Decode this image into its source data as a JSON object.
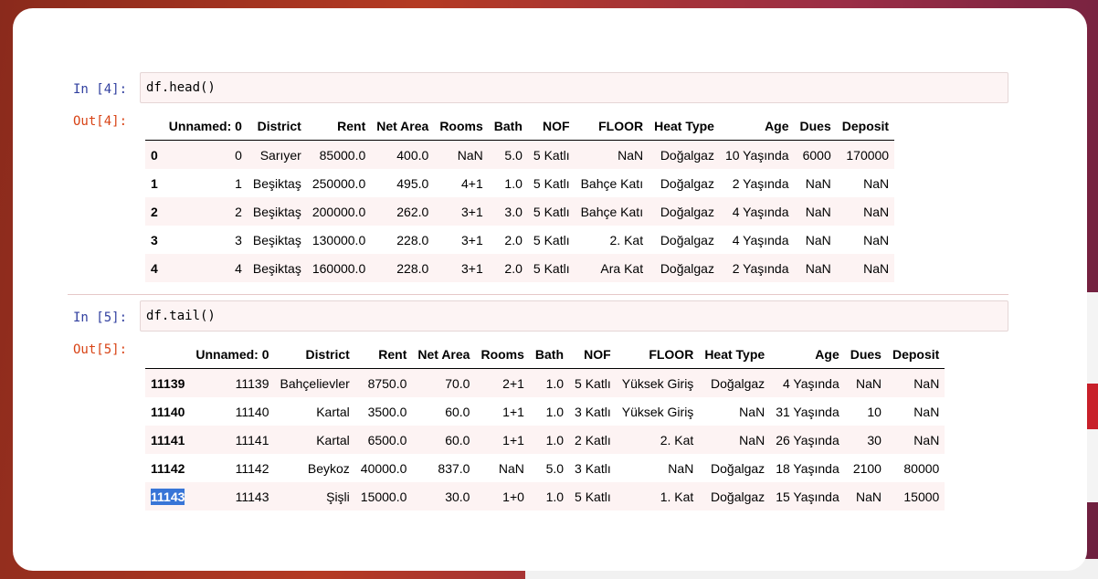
{
  "cells": [
    {
      "in_prompt": "In [4]:",
      "code": "df.head()",
      "out_prompt": "Out[4]:",
      "columns": [
        "",
        "Unnamed: 0",
        "District",
        "Rent",
        "Net Area",
        "Rooms",
        "Bath",
        "NOF",
        "FLOOR",
        "Heat Type",
        "Age",
        "Dues",
        "Deposit"
      ],
      "rows": [
        [
          "0",
          "0",
          "Sarıyer",
          "85000.0",
          "400.0",
          "NaN",
          "5.0",
          "5 Katlı",
          "NaN",
          "Doğalgaz",
          "10 Yaşında",
          "6000",
          "170000"
        ],
        [
          "1",
          "1",
          "Beşiktaş",
          "250000.0",
          "495.0",
          "4+1",
          "1.0",
          "5 Katlı",
          "Bahçe Katı",
          "Doğalgaz",
          "2 Yaşında",
          "NaN",
          "NaN"
        ],
        [
          "2",
          "2",
          "Beşiktaş",
          "200000.0",
          "262.0",
          "3+1",
          "3.0",
          "5 Katlı",
          "Bahçe Katı",
          "Doğalgaz",
          "4 Yaşında",
          "NaN",
          "NaN"
        ],
        [
          "3",
          "3",
          "Beşiktaş",
          "130000.0",
          "228.0",
          "3+1",
          "2.0",
          "5 Katlı",
          "2. Kat",
          "Doğalgaz",
          "4 Yaşında",
          "NaN",
          "NaN"
        ],
        [
          "4",
          "4",
          "Beşiktaş",
          "160000.0",
          "228.0",
          "3+1",
          "2.0",
          "5 Katlı",
          "Ara Kat",
          "Doğalgaz",
          "2 Yaşında",
          "NaN",
          "NaN"
        ]
      ]
    },
    {
      "in_prompt": "In [5]:",
      "code": "df.tail()",
      "out_prompt": "Out[5]:",
      "columns": [
        "",
        "Unnamed: 0",
        "District",
        "Rent",
        "Net Area",
        "Rooms",
        "Bath",
        "NOF",
        "FLOOR",
        "Heat Type",
        "Age",
        "Dues",
        "Deposit"
      ],
      "rows": [
        [
          "11139",
          "11139",
          "Bahçelievler",
          "8750.0",
          "70.0",
          "2+1",
          "1.0",
          "5 Katlı",
          "Yüksek Giriş",
          "Doğalgaz",
          "4 Yaşında",
          "NaN",
          "NaN"
        ],
        [
          "11140",
          "11140",
          "Kartal",
          "3500.0",
          "60.0",
          "1+1",
          "1.0",
          "3 Katlı",
          "Yüksek Giriş",
          "NaN",
          "31 Yaşında",
          "10",
          "NaN"
        ],
        [
          "11141",
          "11141",
          "Kartal",
          "6500.0",
          "60.0",
          "1+1",
          "1.0",
          "2 Katlı",
          "2. Kat",
          "NaN",
          "26 Yaşında",
          "30",
          "NaN"
        ],
        [
          "11142",
          "11142",
          "Beykoz",
          "40000.0",
          "837.0",
          "NaN",
          "5.0",
          "3 Katlı",
          "NaN",
          "Doğalgaz",
          "18 Yaşında",
          "2100",
          "80000"
        ],
        [
          "11143",
          "11143",
          "Şişli",
          "15000.0",
          "30.0",
          "1+0",
          "1.0",
          "5 Katlı",
          "1. Kat",
          "Doğalgaz",
          "15 Yaşında",
          "NaN",
          "15000"
        ]
      ],
      "selected_index_label": "11143"
    }
  ],
  "colors": {
    "prompt_in": "#303f9f",
    "prompt_out": "#d84315",
    "selection": "#3875d7"
  }
}
